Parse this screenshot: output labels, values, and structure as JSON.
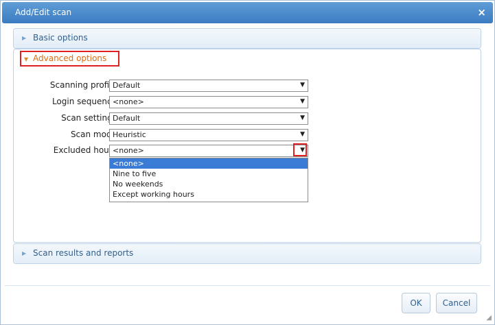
{
  "dialog": {
    "title": "Add/Edit scan",
    "close_icon": "×"
  },
  "sections": {
    "basic": {
      "label": "Basic options",
      "arrow": "▶"
    },
    "advanced": {
      "label": "Advanced options",
      "arrow": "▼"
    },
    "results": {
      "label": "Scan results and reports",
      "arrow": "▶"
    }
  },
  "form": {
    "scanning_profile": {
      "label": "Scanning profile:",
      "value": "Default"
    },
    "login_sequence": {
      "label": "Login sequence:",
      "value": "<none>"
    },
    "scan_settings": {
      "label": "Scan settings:",
      "value": "Default"
    },
    "scan_mode": {
      "label": "Scan mode:",
      "value": "Heuristic"
    },
    "excluded_hours": {
      "label": "Excluded hours:",
      "value": "<none>",
      "options": [
        "<none>",
        "Nine to five",
        "No weekends",
        "Except working hours"
      ]
    }
  },
  "dropdown_arrow": "▼",
  "buttons": {
    "ok": "OK",
    "cancel": "Cancel"
  },
  "resize_grip": "◢"
}
